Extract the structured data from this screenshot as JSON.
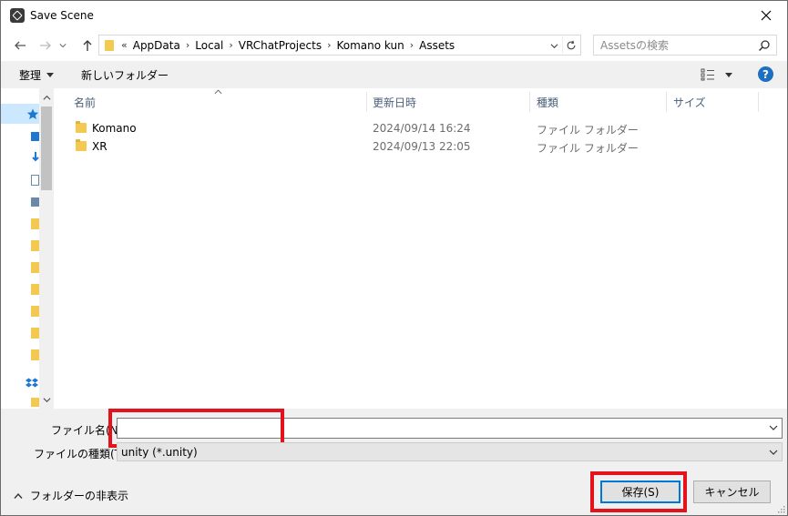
{
  "window": {
    "title": "Save Scene"
  },
  "address": {
    "overflow": "«",
    "crumbs": [
      "AppData",
      "Local",
      "VRChatProjects",
      "Komano kun",
      "Assets"
    ],
    "separator": "›"
  },
  "search": {
    "placeholder": "Assetsの検索"
  },
  "commands": {
    "organize": "整理",
    "new_folder": "新しいフォルダー"
  },
  "columns": {
    "name": "名前",
    "modified": "更新日時",
    "type": "種類",
    "size": "サイズ"
  },
  "files": [
    {
      "name": "Komano",
      "modified": "2024/09/14 16:24",
      "type": "ファイル フォルダー"
    },
    {
      "name": "XR",
      "modified": "2024/09/13 22:05",
      "type": "ファイル フォルダー"
    }
  ],
  "form": {
    "filename_label": "ファイル名(N):",
    "filename_value": "",
    "filetype_label": "ファイルの種類(T):",
    "filetype_value": "unity (*.unity)"
  },
  "footer": {
    "hide_folders": "フォルダーの非表示",
    "save": "保存(S)",
    "cancel": "キャンセル"
  },
  "colors": {
    "highlight": "#e3121b",
    "accent": "#0078d7",
    "help": "#1c6fc1"
  }
}
